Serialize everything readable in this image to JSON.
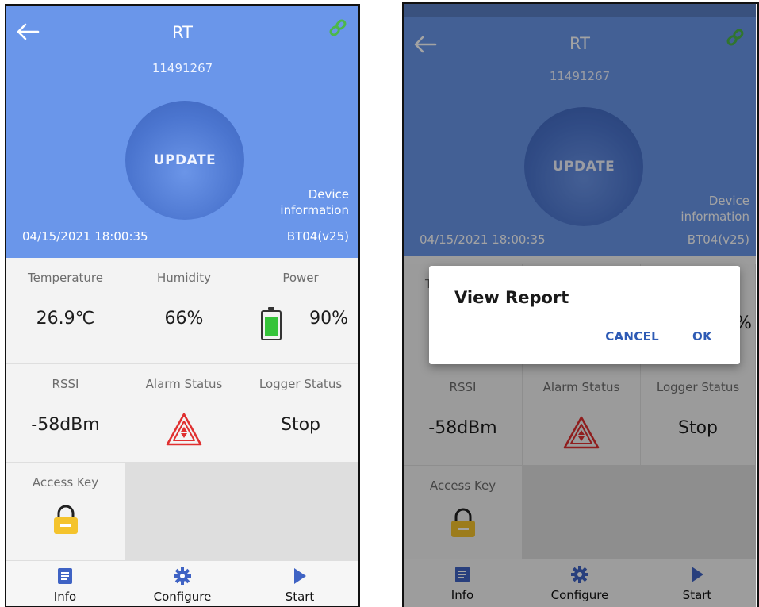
{
  "device": {
    "title": "RT",
    "serial": "11491267",
    "update_label": "UPDATE",
    "device_info_line1": "Device",
    "device_info_line2": "information",
    "datetime": "04/15/2021 18:00:35",
    "model": "BT04(v25)"
  },
  "metrics": {
    "temperature": {
      "label": "Temperature",
      "value": "26.9℃"
    },
    "humidity": {
      "label": "Humidity",
      "value": "66%"
    },
    "power": {
      "label": "Power",
      "value": "90%",
      "level": 0.9
    },
    "rssi": {
      "label": "RSSI",
      "value": "-58dBm"
    },
    "alarm": {
      "label": "Alarm Status",
      "icon": "alarm-triangle-icon"
    },
    "logger": {
      "label": "Logger Status",
      "value": "Stop"
    },
    "access_key": {
      "label": "Access Key",
      "icon": "lock-icon"
    }
  },
  "nav": {
    "info": "Info",
    "configure": "Configure",
    "start": "Start"
  },
  "dialog": {
    "title": "View Report",
    "cancel": "CANCEL",
    "ok": "OK"
  },
  "colors": {
    "header": "#6a96ea",
    "link": "#4cb84a",
    "alarm": "#e03030",
    "battery": "#35c43a",
    "lock": "#f4c32c",
    "dialog_button": "#2e5bb5"
  }
}
